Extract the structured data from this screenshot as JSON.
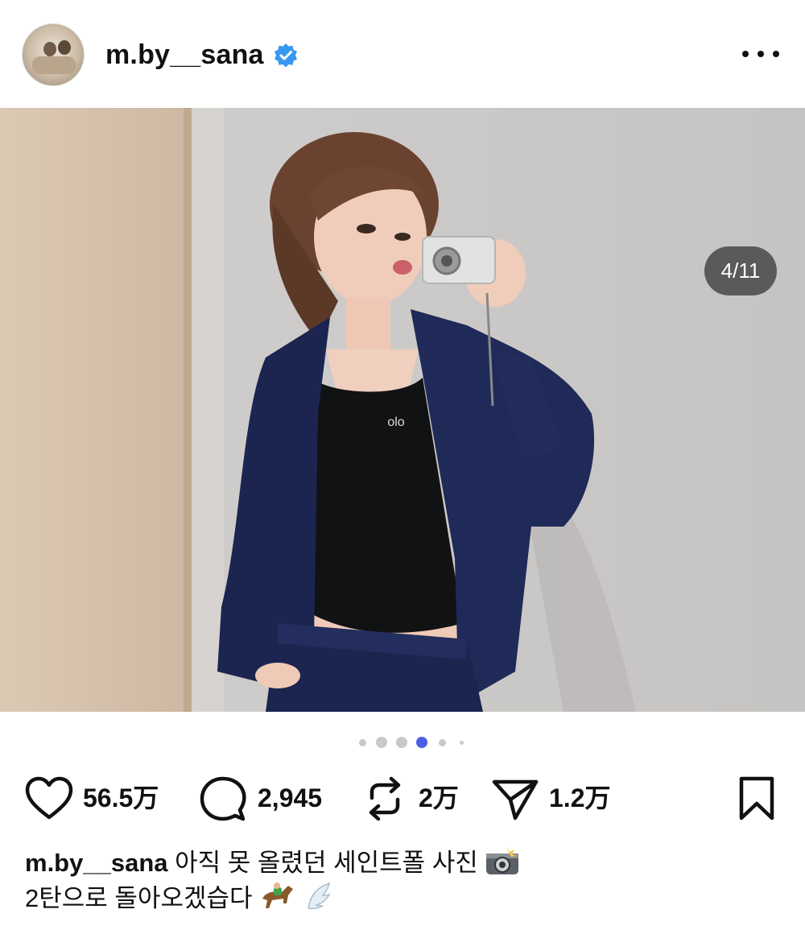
{
  "post": {
    "username": "m.by__sana",
    "verified": true,
    "carousel_counter": "4/11",
    "carousel_total_dots": 6,
    "carousel_active_dot": 4
  },
  "actions": {
    "likes": "56.5万",
    "comments": "2,945",
    "reposts": "2万",
    "shares": "1.2万"
  },
  "caption": {
    "username": "m.by__sana",
    "line1": " 아직 못 올렸던 세인트폴 사진",
    "line2": "2탄으로 돌아오겠습다"
  },
  "icons": {
    "more": "more-options-icon",
    "verified": "verified-badge-icon",
    "like": "heart-icon",
    "comment": "comment-bubble-icon",
    "repost": "repost-icon",
    "share": "send-paper-plane-icon",
    "save": "bookmark-icon",
    "caption_emojis": [
      "camera-flash-emoji",
      "horse-racing-emoji",
      "wing-emoji"
    ]
  },
  "colors": {
    "verified": "#3897f0",
    "active_dot": "#4a5fe6",
    "inactive_dot": "#c8c8c8",
    "text": "#111111"
  }
}
